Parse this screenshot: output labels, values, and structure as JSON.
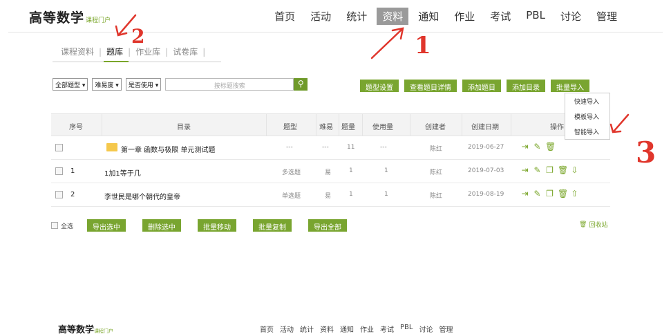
{
  "header": {
    "logo_main": "高等数学",
    "logo_sub": "课程门户",
    "nav": [
      "首页",
      "活动",
      "统计",
      "资料",
      "通知",
      "作业",
      "考试",
      "PBL",
      "讨论",
      "管理"
    ],
    "active_nav": "资料"
  },
  "subtabs": [
    "课程资料",
    "题库",
    "作业库",
    "试卷库"
  ],
  "active_subtab": "题库",
  "filters": {
    "type": "全部题型",
    "difficulty": "难易度",
    "used": "是否使用",
    "search_placeholder": "按标题搜索"
  },
  "actions": [
    "题型设置",
    "查看题目详情",
    "添加题目",
    "添加目录",
    "批量导入"
  ],
  "import_menu": [
    "快速导入",
    "模板导入",
    "智能导入"
  ],
  "table": {
    "headers": [
      "序号",
      "目录",
      "题型",
      "难易",
      "题量",
      "使用量",
      "创建者",
      "创建日期",
      "操作"
    ],
    "rows": [
      {
        "index": "",
        "title": "第一章 函数与极限 单元测试题",
        "type": "---",
        "difficulty": "---",
        "count": "11",
        "usage": "---",
        "creator": "陈红",
        "date": "2019-06-27"
      },
      {
        "index": "1",
        "title": "1加1等于几",
        "type": "多选题",
        "difficulty": "易",
        "count": "1",
        "usage": "1",
        "creator": "陈红",
        "date": "2019-07-03"
      },
      {
        "index": "2",
        "title": "李世民是哪个朝代的皇帝",
        "type": "单选题",
        "difficulty": "易",
        "count": "1",
        "usage": "1",
        "creator": "陈红",
        "date": "2019-08-19"
      }
    ]
  },
  "bottom": {
    "select_all": "全选",
    "buttons": [
      "导出选中",
      "删除选中",
      "批量移动",
      "批量复制",
      "导出全部"
    ],
    "recycle": "回收站"
  },
  "footer": {
    "logo_main": "高等数学",
    "logo_sub": "课程门户",
    "nav": [
      "首页",
      "活动",
      "统计",
      "资料",
      "通知",
      "作业",
      "考试",
      "PBL",
      "讨论",
      "管理"
    ]
  },
  "annotations": [
    "1",
    "2",
    "3"
  ],
  "colors": {
    "accent_green": "#79a530",
    "annotation_red": "#e0362c",
    "active_nav_bg": "#9a9a9a"
  }
}
